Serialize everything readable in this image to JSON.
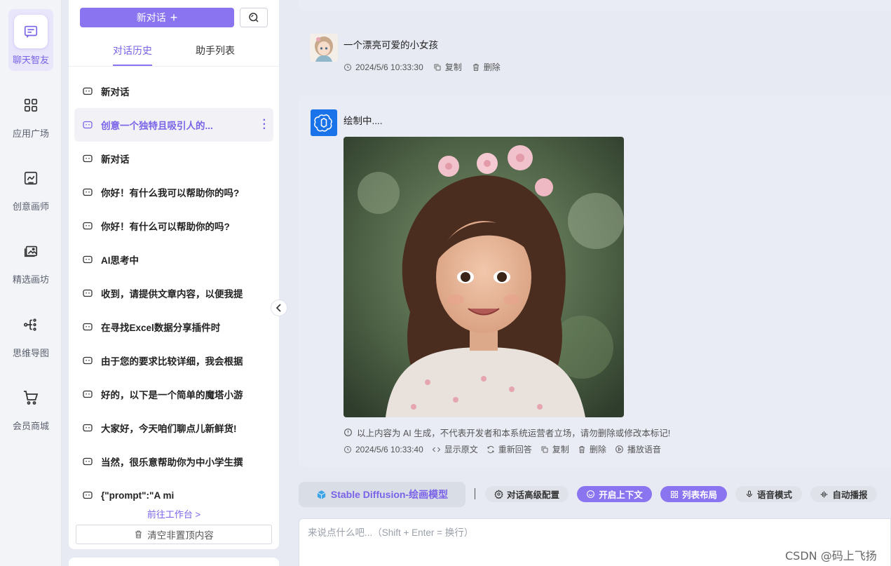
{
  "rail": {
    "items": [
      {
        "label": "聊天智友",
        "icon": "chat-icon",
        "active": true
      },
      {
        "label": "应用广场",
        "icon": "grid-icon"
      },
      {
        "label": "创意画师",
        "icon": "drawing-board-icon"
      },
      {
        "label": "精选画坊",
        "icon": "gallery-icon"
      },
      {
        "label": "思维导图",
        "icon": "mindmap-icon"
      },
      {
        "label": "会员商城",
        "icon": "cart-icon"
      }
    ]
  },
  "history": {
    "new_chat_label": "新对话",
    "tabs": [
      "对话历史",
      "助手列表"
    ],
    "items": [
      "新对话",
      "创意一个独特且吸引人的...",
      "新对话",
      "你好！有什么我可以帮助你的吗?",
      "你好！有什么可以帮助你的吗?",
      "AI思考中",
      "收到，请提供文章内容，以便我提",
      "在寻找Excel数据分享插件时",
      "由于您的要求比较详细，我会根据",
      "好的，以下是一个简单的魔塔小游",
      "大家好，今天咱们聊点儿新鲜货!",
      "当然，很乐意帮助你为中小学生撰",
      "{\"prompt\":\"A mi"
    ],
    "goto_workbench": "前往工作台 >",
    "clear_label": "清空非置顶内容"
  },
  "user_message": {
    "text": "一个漂亮可爱的小女孩",
    "time": "2024/5/6 10:33:30",
    "copy": "复制",
    "delete": "删除"
  },
  "ai_message": {
    "status": "绘制中....",
    "disclaimer": "以上内容为 AI 生成，不代表开发者和本系统运营者立场，请勿删除或修改本标记!",
    "time": "2024/5/6 10:33:40",
    "show_original": "显示原文",
    "regenerate": "重新回答",
    "copy": "复制",
    "delete": "删除",
    "play_voice": "播放语音"
  },
  "toolbar": {
    "model": "Stable Diffusion-绘画模型",
    "advanced": "对话高级配置",
    "context": "开启上下文",
    "layout": "列表布局",
    "voice_mode": "语音模式",
    "auto_play": "自动播报"
  },
  "input": {
    "placeholder": "来说点什么吧...（Shift + Enter = 换行）"
  },
  "watermark": "CSDN @码上飞扬",
  "colors": {
    "accent": "#8b74f0",
    "ai_avatar": "#1a73e8"
  }
}
